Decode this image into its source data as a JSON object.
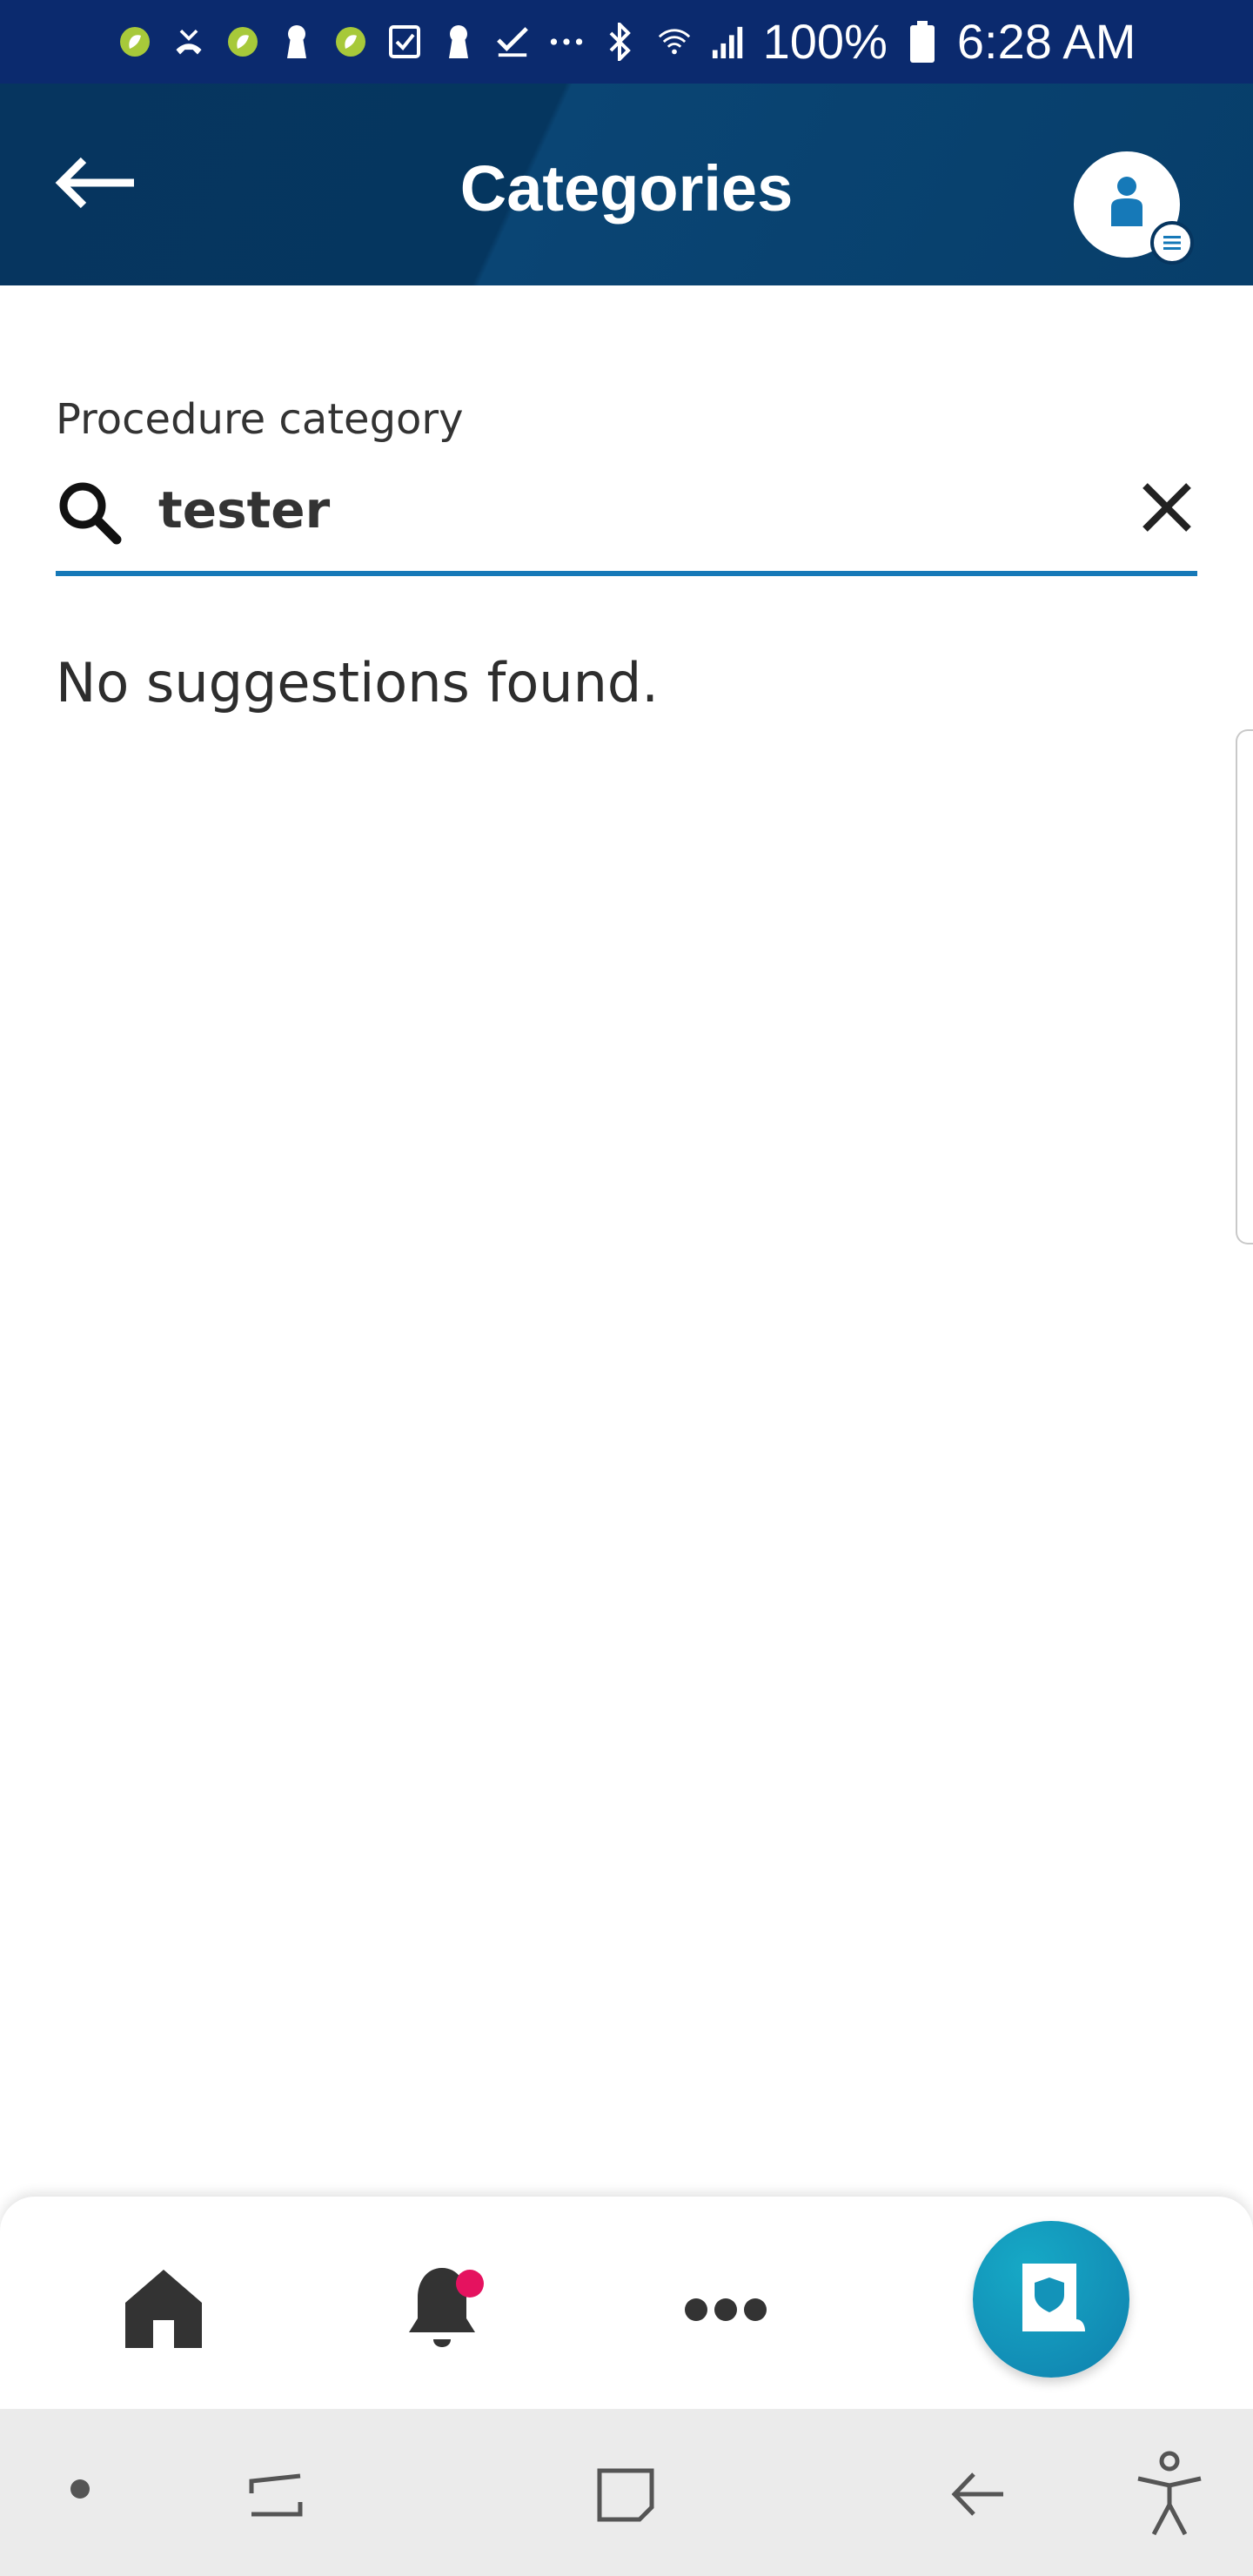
{
  "status_bar": {
    "battery": "100%",
    "time": "6:28 AM",
    "icons": [
      "app-icon",
      "missed-call-icon",
      "app-icon",
      "keyhole-icon",
      "app-icon",
      "checkbox-icon",
      "keyhole-icon",
      "checkmark-icon",
      "more-icon",
      "bluetooth-icon",
      "wifi-icon",
      "signal-icon",
      "battery-icon"
    ]
  },
  "header": {
    "title": "Categories",
    "back_icon": "arrow-left-icon",
    "profile_icon": "profile-icon"
  },
  "search": {
    "label": "Procedure category",
    "value": "tester",
    "clear_icon": "close-icon"
  },
  "results": {
    "empty_message": "No suggestions found."
  },
  "bottom_nav": {
    "items": [
      "home-icon",
      "bell-icon",
      "more-icon",
      "policy-icon"
    ],
    "notification_dot_color": "#e5125f",
    "fab_color": "#1393b9"
  },
  "colors": {
    "status_bar": "#0b2a6e",
    "app_bar": "#06355f",
    "accent": "#1679b8"
  }
}
